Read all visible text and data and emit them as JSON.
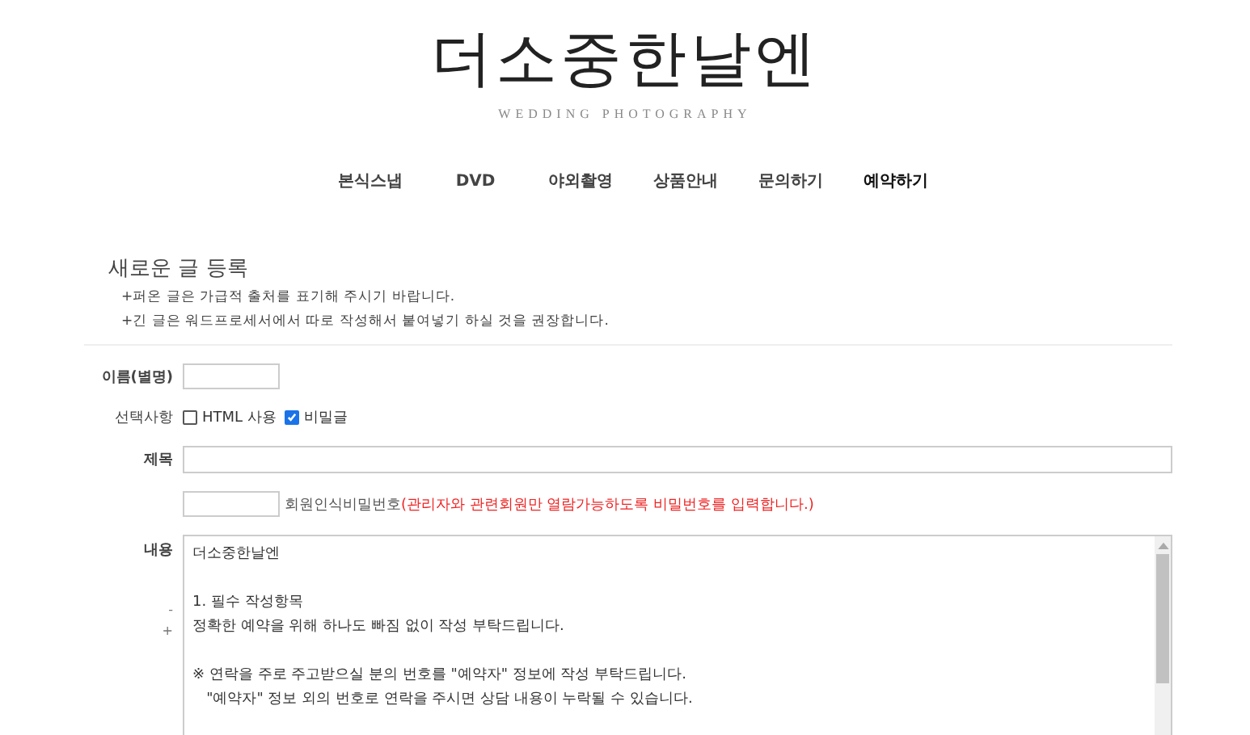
{
  "logo": {
    "title": "더소중한날엔",
    "subtitle": "WEDDING PHOTOGRAPHY"
  },
  "nav": [
    {
      "label": "본식스냅",
      "selected": false
    },
    {
      "label": "DVD",
      "selected": false
    },
    {
      "label": "야외촬영",
      "selected": false
    },
    {
      "label": "상품안내",
      "selected": false
    },
    {
      "label": "문의하기",
      "selected": false
    },
    {
      "label": "예약하기",
      "selected": true
    }
  ],
  "form": {
    "heading": "새로운 글 등록",
    "notes": [
      "+퍼온 글은 가급적 출처를 표기해 주시기 바랍니다.",
      "+긴 글은 워드프로세서에서 따로 작성해서 붙여넣기 하실 것을 권장합니다."
    ],
    "name_label": "이름(별명)",
    "options_label": "선택사항",
    "options": [
      {
        "label": "HTML 사용",
        "checked": false
      },
      {
        "label": "비밀글",
        "checked": true
      }
    ],
    "subject_label": "제목",
    "password_label": "회원인식비밀번호",
    "password_hint": "(관리자와 관련회원만 열람가능하도록 비밀번호를 입력합니다.)",
    "content_label": "내용",
    "resize_controls": [
      "-",
      "+"
    ],
    "content_paragraphs": [
      [
        "더소중한날엔"
      ],
      [
        "1. 필수 작성항목",
        "정확한 예약을 위해 하나도 빠짐 없이 작성 부탁드립니다."
      ],
      [
        "※ 연락을 주로 주고받으실 분의 번호를 \"예약자\" 정보에 작성 부탁드립니다.",
        "   \"예약자\" 정보 외의 번호로 연락을 주시면 상담 내용이 누락될 수 있습니다."
      ]
    ]
  }
}
